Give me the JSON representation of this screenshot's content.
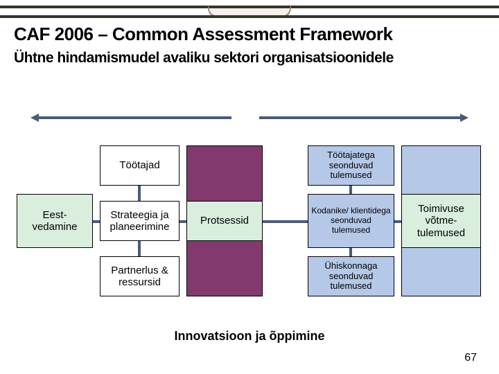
{
  "header": {
    "title": "CAF 2006 – Common Assessment Framework",
    "subtitle": "Ühtne hindamismudel avaliku sektori organisatsioonidele"
  },
  "boxes": {
    "leadership": "Eest-vedamine",
    "people": "Töötajad",
    "strategy": "Strateegia ja planeerimine",
    "partnership": "Partnerlus & ressursid",
    "processes": "Protsessid",
    "people_results": "Töötajatega seonduvad tulemused",
    "citizen_results": "Kodanike/ klientidega seonduvad tulemused",
    "society_results": "Ühiskonnaga seonduvad tulemused",
    "key_results": "Toimivuse võtme-tulemused"
  },
  "footer": {
    "innovation": "Innovatsioon ja õppimine"
  },
  "page_number": "67"
}
